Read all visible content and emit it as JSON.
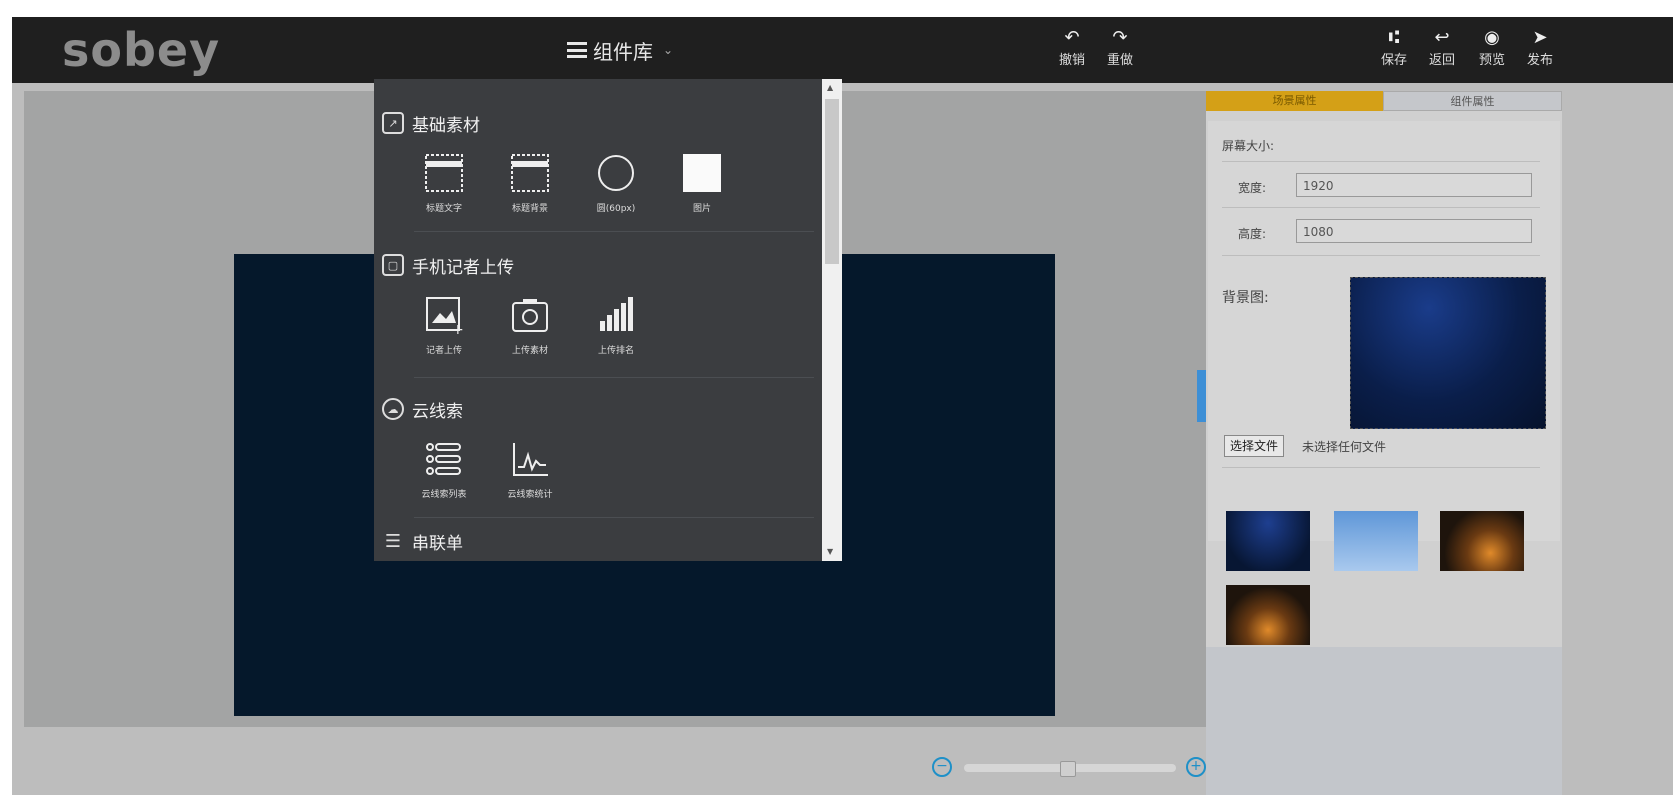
{
  "header": {
    "logo": "sobey",
    "library_label": "组件库",
    "undo_label": "撤销",
    "redo_label": "重做",
    "save_label": "保存",
    "back_label": "返回",
    "preview_label": "预览",
    "publish_label": "发布"
  },
  "library": {
    "sections": [
      {
        "title": "基础素材",
        "items": [
          "标题文字",
          "标题背景",
          "圆(60px)",
          "图片"
        ]
      },
      {
        "title": "手机记者上传",
        "items": [
          "记者上传",
          "上传素材",
          "上传排名"
        ]
      },
      {
        "title": "云线索",
        "items": [
          "云线索列表",
          "云线索统计"
        ]
      },
      {
        "title": "串联单",
        "items": []
      }
    ]
  },
  "right_panel": {
    "tab_active": "场景属性",
    "tab_inactive": "组件属性",
    "screen_size_label": "屏幕大小:",
    "width_label": "宽度:",
    "width_value": "1920",
    "height_label": "高度:",
    "height_value": "1080",
    "background_label": "背景图:",
    "choose_file_label": "选择文件",
    "no_file_label": "未选择任何文件"
  },
  "colors": {
    "topbar": "#1f1f1f",
    "screen": "#05182b",
    "accent_tab": "#d4a017",
    "zoom_accent": "#1e90c8"
  }
}
